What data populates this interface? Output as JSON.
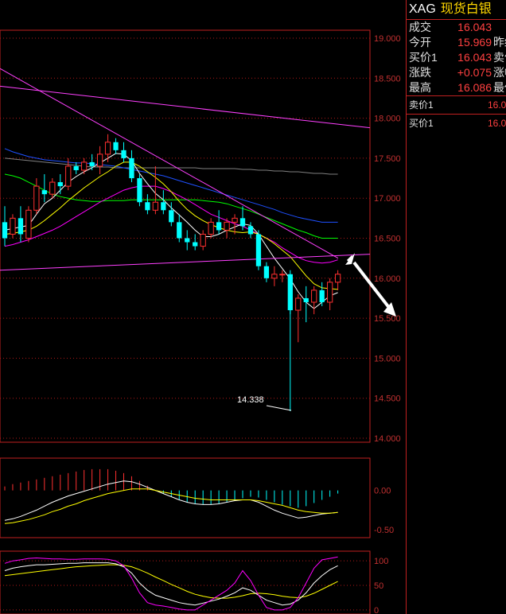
{
  "quote": {
    "symbol": "XAG",
    "name": "现货白银",
    "rows": [
      {
        "label": "成交",
        "value": "16.043",
        "label2": ""
      },
      {
        "label": "今开",
        "value": "15.969",
        "label2": "昨结"
      },
      {
        "label": "买价1",
        "value": "16.043",
        "label2": "卖价"
      },
      {
        "label": "涨跌",
        "value": "+0.075",
        "label2": "涨幅"
      },
      {
        "label": "最高",
        "value": "16.086",
        "label2": "最低"
      }
    ],
    "orderbook": [
      {
        "label": "卖价1",
        "value": "16.0"
      },
      {
        "label": "买价1",
        "value": "16.0"
      }
    ]
  },
  "chart_data": [
    {
      "type": "candlestick",
      "title": "",
      "y_ticks": [
        "19.000",
        "18.500",
        "18.000",
        "17.500",
        "17.000",
        "16.500",
        "16.000",
        "15.500",
        "15.000",
        "14.500",
        "14.000"
      ],
      "ylim": [
        14.0,
        19.0
      ],
      "annotation": "14.338",
      "colors": {
        "up": "#ff3030",
        "down": "#00ffff",
        "ma5": "#ffffff",
        "ma10": "#ffff00",
        "ma20": "#ff00ff",
        "ma30": "#00ff00",
        "ma60": "#1e50ff",
        "ma120": "#808080",
        "trend": "#ff40ff"
      },
      "candles": [
        [
          16.7,
          16.9,
          16.4,
          16.5
        ],
        [
          16.55,
          16.8,
          16.5,
          16.75
        ],
        [
          16.75,
          16.9,
          16.45,
          16.55
        ],
        [
          16.5,
          16.9,
          16.45,
          16.85
        ],
        [
          16.85,
          17.25,
          16.8,
          17.15
        ],
        [
          17.1,
          17.3,
          16.95,
          17.05
        ],
        [
          17.05,
          17.25,
          17.0,
          17.2
        ],
        [
          17.2,
          17.3,
          17.05,
          17.15
        ],
        [
          17.15,
          17.5,
          17.1,
          17.4
        ],
        [
          17.4,
          17.45,
          17.3,
          17.35
        ],
        [
          17.35,
          17.5,
          17.3,
          17.45
        ],
        [
          17.45,
          17.55,
          17.35,
          17.4
        ],
        [
          17.4,
          17.65,
          17.3,
          17.55
        ],
        [
          17.55,
          17.8,
          17.45,
          17.7
        ],
        [
          17.7,
          17.75,
          17.55,
          17.6
        ],
        [
          17.6,
          17.7,
          17.45,
          17.5
        ],
        [
          17.5,
          17.6,
          17.2,
          17.25
        ],
        [
          17.25,
          17.3,
          16.9,
          16.95
        ],
        [
          16.95,
          17.05,
          16.8,
          16.85
        ],
        [
          16.85,
          17.4,
          16.8,
          16.95
        ],
        [
          16.95,
          17.1,
          16.8,
          16.85
        ],
        [
          16.85,
          16.95,
          16.65,
          16.7
        ],
        [
          16.7,
          16.8,
          16.45,
          16.5
        ],
        [
          16.5,
          16.6,
          16.35,
          16.45
        ],
        [
          16.45,
          16.55,
          16.35,
          16.4
        ],
        [
          16.4,
          16.6,
          16.35,
          16.55
        ],
        [
          16.55,
          16.75,
          16.5,
          16.7
        ],
        [
          16.7,
          16.85,
          16.55,
          16.6
        ],
        [
          16.6,
          16.75,
          16.5,
          16.7
        ],
        [
          16.7,
          16.8,
          16.55,
          16.75
        ],
        [
          16.75,
          16.9,
          16.6,
          16.65
        ],
        [
          16.65,
          16.7,
          16.5,
          16.55
        ],
        [
          16.55,
          16.6,
          16.1,
          16.15
        ],
        [
          16.15,
          16.2,
          15.95,
          16.0
        ],
        [
          16.0,
          16.15,
          15.9,
          16.05
        ],
        [
          16.05,
          16.1,
          15.95,
          16.05
        ],
        [
          16.05,
          16.1,
          15.55,
          15.6
        ],
        [
          15.6,
          15.8,
          15.2,
          15.75
        ],
        [
          15.75,
          15.9,
          15.45,
          15.7
        ],
        [
          15.7,
          15.9,
          15.55,
          15.85
        ],
        [
          15.85,
          15.95,
          15.65,
          15.7
        ],
        [
          15.7,
          16.0,
          15.6,
          15.95
        ],
        [
          15.95,
          16.1,
          15.85,
          16.05
        ]
      ],
      "x_count": 43,
      "ma5": [
        16.6,
        16.62,
        16.64,
        16.66,
        16.8,
        16.93,
        17.0,
        17.1,
        17.2,
        17.27,
        17.33,
        17.38,
        17.44,
        17.5,
        17.56,
        17.55,
        17.47,
        17.31,
        17.18,
        17.06,
        16.98,
        16.88,
        16.79,
        16.7,
        16.6,
        16.52,
        16.52,
        16.55,
        16.6,
        16.64,
        16.68,
        16.66,
        16.55,
        16.4,
        16.25,
        16.12,
        15.99,
        15.83,
        15.7,
        15.62,
        15.7,
        15.78,
        15.82
      ],
      "ma10": [
        16.55,
        16.56,
        16.58,
        16.6,
        16.65,
        16.72,
        16.8,
        16.88,
        16.97,
        17.05,
        17.13,
        17.2,
        17.27,
        17.33,
        17.4,
        17.45,
        17.45,
        17.4,
        17.33,
        17.26,
        17.18,
        17.08,
        16.96,
        16.86,
        16.78,
        16.72,
        16.67,
        16.63,
        16.6,
        16.58,
        16.57,
        16.58,
        16.55,
        16.5,
        16.43,
        16.35,
        16.27,
        16.15,
        16.03,
        15.93,
        15.88,
        15.87,
        15.86
      ],
      "ma20": [
        16.4,
        16.42,
        16.45,
        16.48,
        16.52,
        16.56,
        16.6,
        16.65,
        16.71,
        16.77,
        16.83,
        16.89,
        16.95,
        17.0,
        17.05,
        17.1,
        17.13,
        17.15,
        17.15,
        17.15,
        17.12,
        17.08,
        17.03,
        16.98,
        16.92,
        16.86,
        16.8,
        16.76,
        16.72,
        16.68,
        16.65,
        16.6,
        16.55,
        16.5,
        16.45,
        16.38,
        16.32,
        16.26,
        16.22,
        16.2,
        16.19,
        16.2,
        16.23
      ],
      "ma30": [
        17.3,
        17.28,
        17.25,
        17.2,
        17.15,
        17.1,
        17.05,
        17.02,
        17.0,
        16.98,
        16.97,
        16.96,
        16.96,
        16.97,
        16.97,
        16.97,
        16.98,
        16.98,
        16.98,
        16.98,
        16.98,
        16.98,
        16.98,
        16.98,
        16.98,
        16.97,
        16.96,
        16.95,
        16.93,
        16.9,
        16.87,
        16.84,
        16.8,
        16.76,
        16.72,
        16.68,
        16.64,
        16.6,
        16.57,
        16.53,
        16.5,
        16.5,
        16.5
      ],
      "ma60": [
        17.62,
        17.58,
        17.55,
        17.52,
        17.5,
        17.48,
        17.47,
        17.46,
        17.45,
        17.44,
        17.44,
        17.43,
        17.42,
        17.41,
        17.4,
        17.38,
        17.36,
        17.34,
        17.32,
        17.3,
        17.28,
        17.25,
        17.22,
        17.19,
        17.16,
        17.13,
        17.1,
        17.07,
        17.04,
        17.01,
        16.98,
        16.95,
        16.92,
        16.89,
        16.86,
        16.82,
        16.79,
        16.76,
        16.74,
        16.72,
        16.7,
        16.7,
        16.7
      ],
      "ma120": [
        17.5,
        17.49,
        17.48,
        17.47,
        17.46,
        17.45,
        17.44,
        17.43,
        17.42,
        17.41,
        17.4,
        17.39,
        17.39,
        17.39,
        17.38,
        17.38,
        17.38,
        17.38,
        17.38,
        17.38,
        17.38,
        17.38,
        17.38,
        17.38,
        17.38,
        17.37,
        17.37,
        17.37,
        17.37,
        17.37,
        17.36,
        17.36,
        17.35,
        17.35,
        17.34,
        17.34,
        17.33,
        17.33,
        17.32,
        17.31,
        17.31,
        17.3,
        17.3
      ]
    },
    {
      "type": "bar",
      "title": "",
      "y_ticks": [
        "0.00",
        "-0.50"
      ],
      "ylim": [
        -0.6,
        0.35
      ],
      "hist": [
        0.05,
        0.08,
        0.1,
        0.12,
        0.14,
        0.16,
        0.18,
        0.2,
        0.22,
        0.24,
        0.26,
        0.27,
        0.27,
        0.27,
        0.25,
        0.22,
        0.18,
        0.12,
        0.06,
        0.0,
        -0.04,
        -0.08,
        -0.12,
        -0.15,
        -0.17,
        -0.18,
        -0.18,
        -0.17,
        -0.15,
        -0.12,
        -0.1,
        -0.08,
        -0.09,
        -0.12,
        -0.15,
        -0.18,
        -0.2,
        -0.22,
        -0.2,
        -0.16,
        -0.12,
        -0.08,
        -0.04
      ],
      "dif": [
        -0.38,
        -0.36,
        -0.33,
        -0.29,
        -0.25,
        -0.2,
        -0.15,
        -0.11,
        -0.07,
        -0.04,
        -0.01,
        0.02,
        0.05,
        0.08,
        0.1,
        0.12,
        0.11,
        0.08,
        0.04,
        0.0,
        -0.04,
        -0.08,
        -0.12,
        -0.15,
        -0.17,
        -0.18,
        -0.18,
        -0.17,
        -0.15,
        -0.13,
        -0.12,
        -0.12,
        -0.15,
        -0.2,
        -0.25,
        -0.29,
        -0.32,
        -0.35,
        -0.34,
        -0.32,
        -0.3,
        -0.29,
        -0.28
      ],
      "dea": [
        -0.42,
        -0.41,
        -0.39,
        -0.37,
        -0.34,
        -0.31,
        -0.27,
        -0.24,
        -0.2,
        -0.17,
        -0.13,
        -0.1,
        -0.07,
        -0.04,
        -0.02,
        0.0,
        0.02,
        0.02,
        0.02,
        0.0,
        -0.02,
        -0.04,
        -0.06,
        -0.08,
        -0.1,
        -0.11,
        -0.12,
        -0.12,
        -0.12,
        -0.12,
        -0.12,
        -0.12,
        -0.13,
        -0.15,
        -0.17,
        -0.19,
        -0.22,
        -0.25,
        -0.27,
        -0.28,
        -0.29,
        -0.29,
        -0.28
      ]
    },
    {
      "type": "line",
      "title": "",
      "y_ticks": [
        "100",
        "50",
        "0"
      ],
      "ylim": [
        -5,
        110
      ],
      "k": [
        80,
        85,
        88,
        90,
        92,
        92,
        93,
        94,
        95,
        95,
        96,
        96,
        96,
        96,
        94,
        88,
        75,
        55,
        40,
        30,
        25,
        20,
        15,
        12,
        10,
        14,
        18,
        22,
        28,
        35,
        45,
        40,
        30,
        20,
        15,
        10,
        12,
        20,
        35,
        55,
        70,
        82,
        90
      ],
      "d": [
        70,
        72,
        74,
        76,
        78,
        80,
        82,
        84,
        86,
        88,
        89,
        90,
        91,
        92,
        92,
        91,
        88,
        82,
        75,
        67,
        60,
        52,
        45,
        38,
        32,
        28,
        25,
        24,
        24,
        26,
        29,
        33,
        34,
        33,
        31,
        28,
        26,
        25,
        28,
        34,
        42,
        50,
        58
      ],
      "j": [
        95,
        100,
        102,
        105,
        106,
        105,
        104,
        104,
        103,
        103,
        104,
        104,
        104,
        103,
        100,
        90,
        65,
        35,
        15,
        10,
        8,
        5,
        2,
        0,
        0,
        10,
        20,
        30,
        40,
        55,
        80,
        60,
        30,
        5,
        0,
        0,
        5,
        25,
        55,
        85,
        102,
        105,
        108
      ]
    }
  ]
}
